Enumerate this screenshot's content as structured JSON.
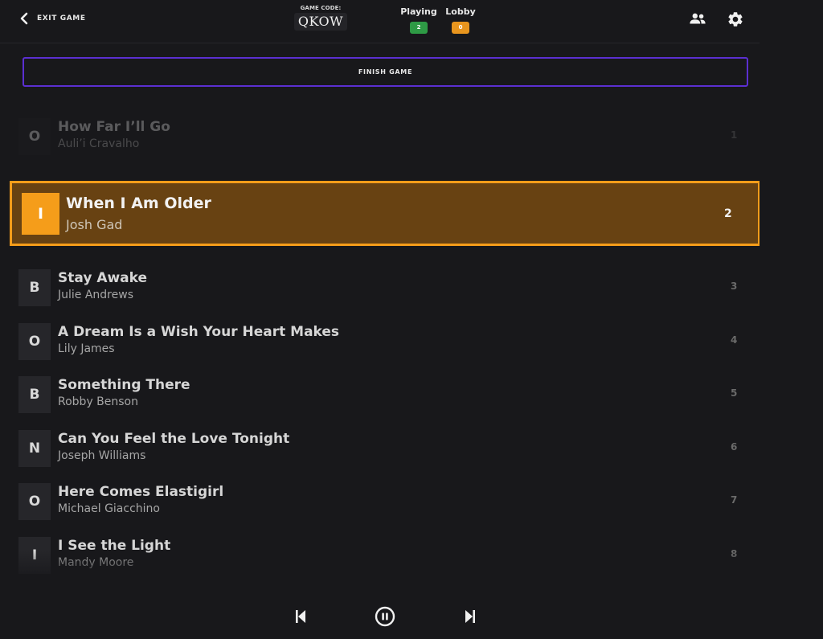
{
  "header": {
    "exit_label": "EXIT GAME",
    "game_code_label": "GAME CODE:",
    "game_code": "QKOW",
    "playing_label": "Playing",
    "playing_count": "2",
    "lobby_label": "Lobby",
    "lobby_count": "0",
    "icons": {
      "back": "chevron-left-icon",
      "players": "people-icon",
      "settings": "gear-icon"
    }
  },
  "finish_button": {
    "label": "FINISH GAME"
  },
  "colors": {
    "background": "#18181b",
    "accent_purple": "#5b2fd1",
    "current_orange": "#f59d1a",
    "current_bg": "#684212",
    "playing_green": "#2e9a45",
    "lobby_orange": "#e8951e"
  },
  "tracks": [
    {
      "letter": "O",
      "title": "How Far I’ll Go",
      "artist": "Auli’i Cravalho",
      "number": "1",
      "state": "played"
    },
    {
      "letter": "I",
      "title": "When I Am Older",
      "artist": "Josh Gad",
      "number": "2",
      "state": "current"
    },
    {
      "letter": "B",
      "title": "Stay Awake",
      "artist": "Julie Andrews",
      "number": "3",
      "state": "upcoming"
    },
    {
      "letter": "O",
      "title": "A Dream Is a Wish Your Heart Makes",
      "artist": "Lily James",
      "number": "4",
      "state": "upcoming"
    },
    {
      "letter": "B",
      "title": "Something There",
      "artist": "Robby Benson",
      "number": "5",
      "state": "upcoming"
    },
    {
      "letter": "N",
      "title": "Can You Feel the Love Tonight",
      "artist": "Joseph Williams",
      "number": "6",
      "state": "upcoming"
    },
    {
      "letter": "O",
      "title": "Here Comes Elastigirl",
      "artist": "Michael Giacchino",
      "number": "7",
      "state": "upcoming"
    },
    {
      "letter": "I",
      "title": "I See the Light",
      "artist": "Mandy Moore",
      "number": "8",
      "state": "upcoming"
    }
  ],
  "controls": {
    "previous": "skip-previous-icon",
    "pause": "pause-circle-icon",
    "next": "skip-next-icon"
  }
}
